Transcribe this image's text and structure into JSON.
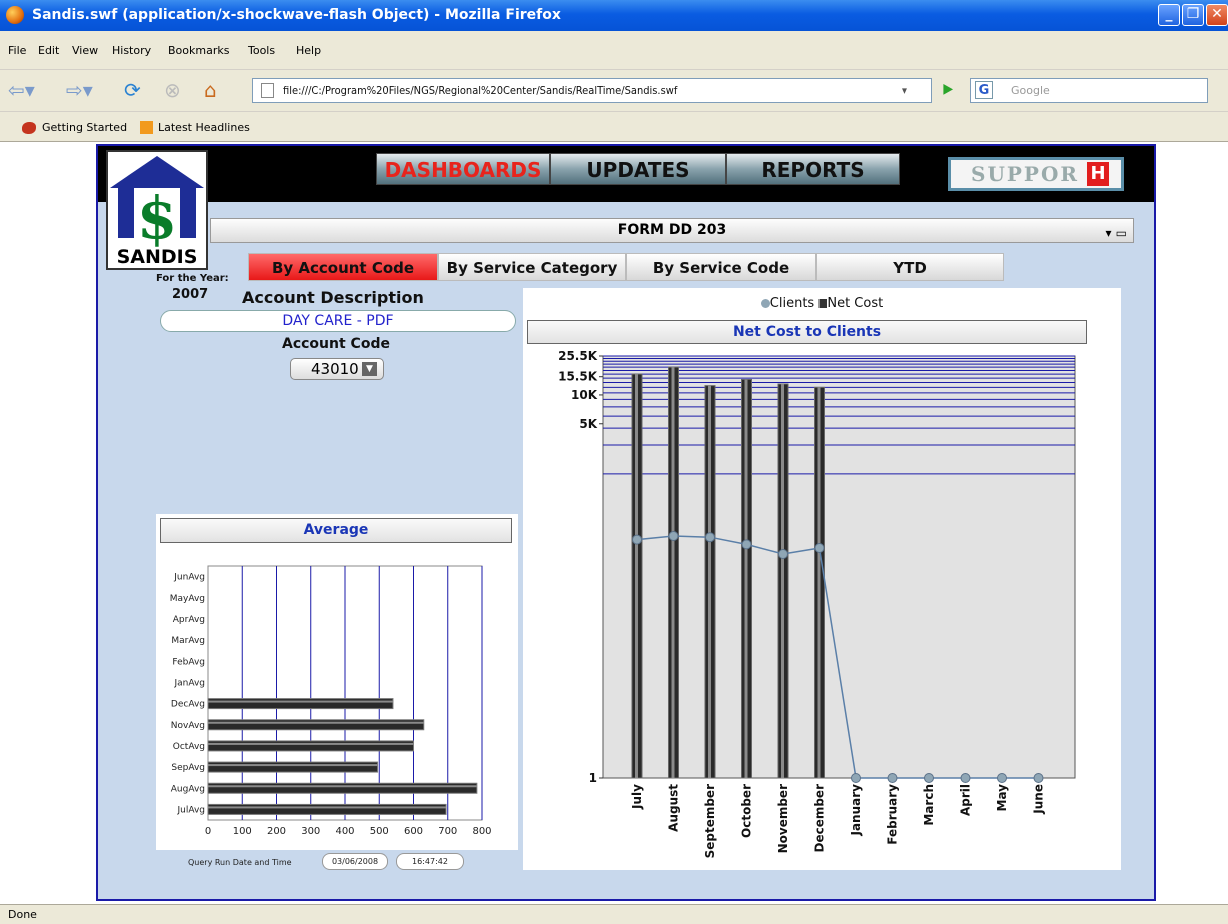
{
  "window": {
    "title": "Sandis.swf (application/x-shockwave-flash Object) - Mozilla Firefox",
    "buttons": [
      "_",
      "❐",
      "✕"
    ]
  },
  "menu": [
    "File",
    "Edit",
    "View",
    "History",
    "Bookmarks",
    "Tools",
    "Help"
  ],
  "nav": {
    "url": "file:///C:/Program%20Files/NGS/Regional%20Center/Sandis/RealTime/Sandis.swf",
    "search_placeholder": "Google",
    "search_engine_letter": "G"
  },
  "bookmarks": [
    "Getting Started",
    "Latest Headlines"
  ],
  "status": "Done",
  "app": {
    "logo_text": "SANDIS",
    "logo_symbol": "$",
    "top_nav": [
      "DASHBOARDS",
      "UPDATES",
      "REPORTS"
    ],
    "active_top_nav": "DASHBOARDS",
    "support": {
      "label": "SUPPOR",
      "icon_letter": "H"
    },
    "form_title": "FORM DD 203",
    "form_controls": "▾ ▭",
    "tabs": [
      "By Account Code",
      "By Service Category",
      "By Service Code",
      "YTD"
    ],
    "active_tab": "By Account Code",
    "year_label": "For the Year:",
    "year": "2007",
    "account_description_label": "Account Description",
    "account_description": "DAY CARE - PDF",
    "account_code_label": "Account Code",
    "account_code": "43010",
    "query_label": "Query Run Date and Time",
    "query_date": "03/06/2008",
    "query_time": "16:47:42"
  },
  "chart_data": [
    {
      "type": "bar",
      "orientation": "horizontal",
      "title": "Average",
      "categories": [
        "JunAvg",
        "MayAvg",
        "AprAvg",
        "MarAvg",
        "FebAvg",
        "JanAvg",
        "DecAvg",
        "NovAvg",
        "OctAvg",
        "SepAvg",
        "AugAvg",
        "JulAvg"
      ],
      "values": [
        0,
        0,
        0,
        0,
        0,
        0,
        540,
        630,
        600,
        495,
        785,
        695
      ],
      "xlim": [
        0,
        800
      ],
      "xticks": [
        0,
        100,
        200,
        300,
        400,
        500,
        600,
        700,
        800
      ],
      "grid": true
    },
    {
      "type": "bar",
      "title": "Net Cost to Clients",
      "yscale": "log",
      "ylim": [
        1,
        25500
      ],
      "yticks": [
        {
          "value": 1,
          "label": "1"
        },
        {
          "value": 5000,
          "label": "5K"
        },
        {
          "value": 10000,
          "label": "10K"
        },
        {
          "value": 15500,
          "label": "15.5K"
        },
        {
          "value": 25500,
          "label": "25.5K"
        }
      ],
      "categories": [
        "July",
        "August",
        "September",
        "October",
        "November",
        "December",
        "January",
        "February",
        "March",
        "April",
        "May",
        "June"
      ],
      "legend": [
        "Clients",
        "Net Cost"
      ],
      "legend_position": "top",
      "series": [
        {
          "name": "Net Cost",
          "type": "bar",
          "values": [
            16500,
            19500,
            12500,
            14500,
            13000,
            12000,
            null,
            null,
            null,
            null,
            null,
            null
          ]
        },
        {
          "name": "Clients",
          "type": "line",
          "values": [
            82,
            85,
            84,
            78,
            70,
            75,
            1,
            1,
            1,
            1,
            1,
            1
          ]
        }
      ],
      "colors": {
        "bars": "#2a2a2a",
        "line": "#5a7fa8",
        "grid": "#1a1aa8"
      }
    }
  ]
}
